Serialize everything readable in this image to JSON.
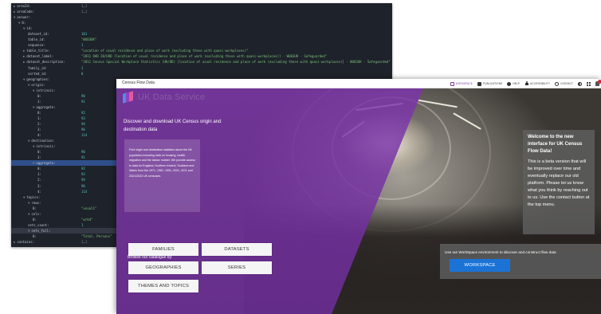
{
  "json_viewer": {
    "rows": [
      {
        "key": "areaId:",
        "value": "[…]",
        "type": "plain",
        "depth": 0,
        "toggle": "▶"
      },
      {
        "key": "areaCode:",
        "value": "[…]",
        "type": "plain",
        "depth": 0,
        "toggle": "▶"
      },
      {
        "key": "answer:",
        "value": "",
        "type": "plain",
        "depth": 0,
        "toggle": "▼"
      },
      {
        "key": "0:",
        "value": "",
        "type": "plain",
        "depth": 1,
        "toggle": "▼"
      },
      {
        "key": "id:",
        "value": "",
        "type": "plain",
        "depth": 2,
        "toggle": "▼"
      },
      {
        "key": "dataset_id:",
        "value": "101",
        "type": "num",
        "depth": 3,
        "toggle": ""
      },
      {
        "key": "table_id:",
        "value": "\"WU03UK\"",
        "type": "str",
        "depth": 3,
        "toggle": ""
      },
      {
        "key": "sequence:",
        "value": "1",
        "type": "num",
        "depth": 3,
        "toggle": ""
      },
      {
        "key": "table_title:",
        "value": "\"Location of usual residence and place of work (excluding those with quasi-workplaces)\"",
        "type": "str",
        "depth": 2,
        "toggle": "▶"
      },
      {
        "key": "dataset_label:",
        "value": "\"2011 OAD 20/UOD [location of usual residence and place of work (excluding those with quasi-workplaces)] - WU03UK - Safeguarded\"",
        "type": "str",
        "depth": 2,
        "toggle": "▶"
      },
      {
        "key": "dataset_description:",
        "value": "\"2011 Census Special Workplace Statistics (UK/OD) [location of usual residence and place of work (excluding those with quasi-workplaces)] - WU03UK - Safeguarded\"",
        "type": "str",
        "depth": 2,
        "toggle": "▶"
      },
      {
        "key": "family_id:",
        "value": "2",
        "type": "num",
        "depth": 3,
        "toggle": ""
      },
      {
        "key": "sorted_id:",
        "value": "0",
        "type": "num",
        "depth": 3,
        "toggle": ""
      },
      {
        "key": "geographies:",
        "value": "",
        "type": "plain",
        "depth": 2,
        "toggle": "▼"
      },
      {
        "key": "origin:",
        "value": "",
        "type": "plain",
        "depth": 3,
        "toggle": "▼"
      },
      {
        "key": "intrinsic:",
        "value": "",
        "type": "plain",
        "depth": 4,
        "toggle": "▼"
      },
      {
        "key": "0:",
        "value": "90",
        "type": "num",
        "depth": 5,
        "toggle": ""
      },
      {
        "key": "1:",
        "value": "91",
        "type": "num",
        "depth": 5,
        "toggle": ""
      },
      {
        "key": "aggregate:",
        "value": "",
        "type": "plain",
        "depth": 4,
        "toggle": "▼"
      },
      {
        "key": "0:",
        "value": "92",
        "type": "num",
        "depth": 5,
        "toggle": ""
      },
      {
        "key": "1:",
        "value": "93",
        "type": "num",
        "depth": 5,
        "toggle": ""
      },
      {
        "key": "2:",
        "value": "94",
        "type": "num",
        "depth": 5,
        "toggle": ""
      },
      {
        "key": "3:",
        "value": "96",
        "type": "num",
        "depth": 5,
        "toggle": ""
      },
      {
        "key": "4:",
        "value": "114",
        "type": "num",
        "depth": 5,
        "toggle": ""
      },
      {
        "key": "destination:",
        "value": "",
        "type": "plain",
        "depth": 3,
        "toggle": "▼"
      },
      {
        "key": "intrinsic:",
        "value": "",
        "type": "plain",
        "depth": 4,
        "toggle": "▼"
      },
      {
        "key": "0:",
        "value": "90",
        "type": "num",
        "depth": 5,
        "toggle": ""
      },
      {
        "key": "1:",
        "value": "91",
        "type": "num",
        "depth": 5,
        "toggle": ""
      },
      {
        "key": "aggregate:",
        "value": "",
        "type": "plain",
        "depth": 4,
        "toggle": "▼",
        "selected": true
      },
      {
        "key": "0:",
        "value": "92",
        "type": "num",
        "depth": 5,
        "toggle": ""
      },
      {
        "key": "1:",
        "value": "93",
        "type": "num",
        "depth": 5,
        "toggle": ""
      },
      {
        "key": "2:",
        "value": "94",
        "type": "num",
        "depth": 5,
        "toggle": ""
      },
      {
        "key": "3:",
        "value": "96",
        "type": "num",
        "depth": 5,
        "toggle": ""
      },
      {
        "key": "4:",
        "value": "114",
        "type": "num",
        "depth": 5,
        "toggle": ""
      },
      {
        "key": "topics:",
        "value": "",
        "type": "plain",
        "depth": 2,
        "toggle": "▼"
      },
      {
        "key": "rows:",
        "value": "",
        "type": "plain",
        "depth": 3,
        "toggle": "▼"
      },
      {
        "key": "0:",
        "value": "\"usual1\"",
        "type": "str",
        "depth": 4,
        "toggle": ""
      },
      {
        "key": "cols:",
        "value": "",
        "type": "plain",
        "depth": 3,
        "toggle": "▼"
      },
      {
        "key": "0:",
        "value": "\"wrkd\"",
        "type": "str",
        "depth": 4,
        "toggle": ""
      },
      {
        "key": "sets_count:",
        "value": "1",
        "type": "num",
        "depth": 3,
        "toggle": ""
      },
      {
        "key": "sets_full:",
        "value": "",
        "type": "plain",
        "depth": 3,
        "toggle": "▼",
        "highlight": true
      },
      {
        "key": "0:",
        "value": "\"Total, Persons\"",
        "type": "str",
        "depth": 4,
        "toggle": ""
      },
      {
        "key": "contains:",
        "value": "[…]",
        "type": "plain",
        "depth": 0,
        "toggle": "▶"
      }
    ]
  },
  "app": {
    "title": "Census Flow Data",
    "nav": [
      {
        "label": "WORKSPACE",
        "icon": "workspace-icon",
        "active": true
      },
      {
        "label": "PUBLICATIONS",
        "icon": "publications-icon",
        "active": false
      },
      {
        "label": "HELP",
        "icon": "help-icon",
        "active": false
      },
      {
        "label": "ACCESSIBILITY",
        "icon": "accessibility-icon",
        "active": false
      },
      {
        "label": "CONTACT",
        "icon": "contact-icon",
        "active": false
      }
    ],
    "accent_color": "#7d3ca5",
    "logo_text": "UK Data Service",
    "tagline": "Discover and download UK Census origin and destination data",
    "info_text": "Find origin and destination statistics about the UK population including data on housing, health, migration and the labour market. We provide access to data for England, Northern Ireland, Scotland and Wales from the 1971, 1981, 1991, 2001, 2011 and 2021/2022 UK censuses.",
    "browse_label": "Browse our catalogue by:",
    "catalogue_buttons": {
      "families": "FAMILIES",
      "datasets": "DATASETS",
      "geographies": "GEOGRAPHIES",
      "series": "SERIES",
      "themes": "THEMES AND TOPICS"
    },
    "welcome_title": "Welcome to the new interface for UK Census Flow Data!",
    "welcome_body": "This is a beta version that will be improved over time and eventually replace our old platform. Please let us know what you think by reaching out to us. Use the contact button at the top menu.",
    "workspace_text": "Use our WorkSpace environment to discover and construct flow data",
    "workspace_button": "WORKSPACE",
    "workspace_button_color": "#1b73d6"
  }
}
